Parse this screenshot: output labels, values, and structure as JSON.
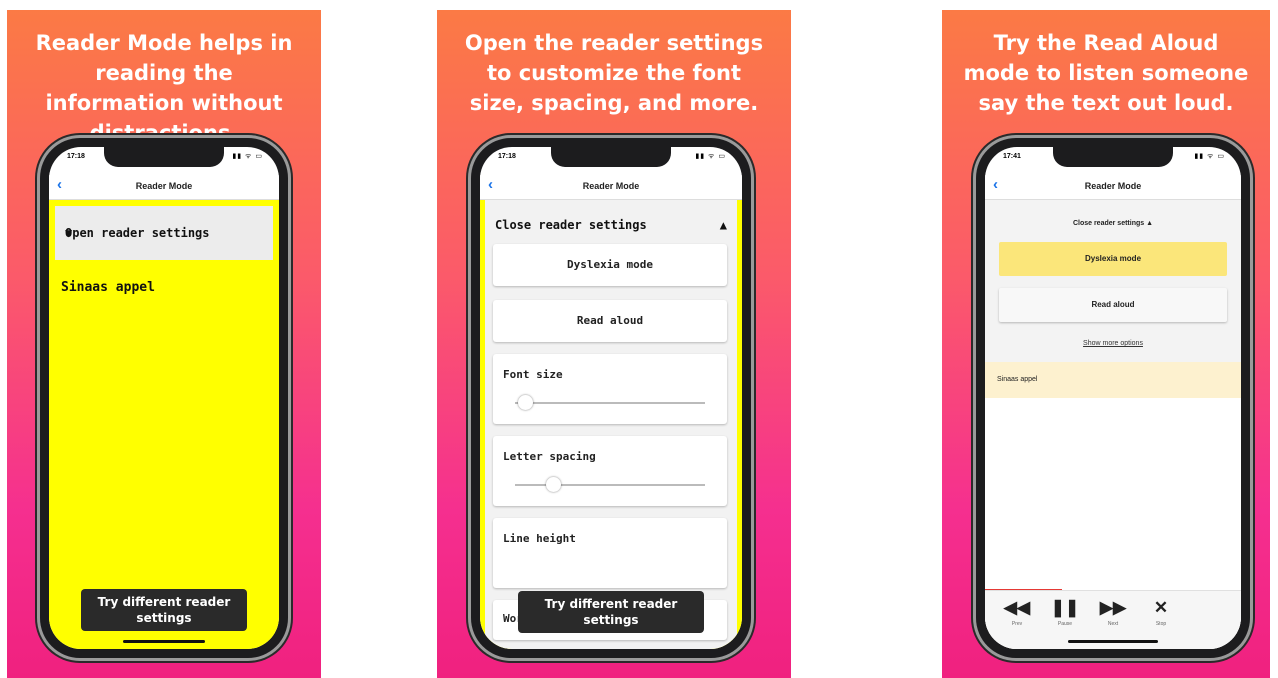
{
  "panels": [
    {
      "caption": "Reader Mode helps in reading the information without distractions.",
      "status_time": "17:18",
      "status_icons": "▮▮ ᯤ ▭",
      "nav_title": "Reader Mode",
      "settings_toggle_label": "Open reader settings",
      "settings_toggle_icon": "▼",
      "body_text": "Sinaas appel",
      "toast": "Try different reader settings"
    },
    {
      "caption": "Open the reader settings to customize the font size, spacing, and more.",
      "status_time": "17:18",
      "status_icons": "▮▮ ᯤ ▭",
      "nav_title": "Reader Mode",
      "settings_toggle_label": "Close reader settings",
      "settings_toggle_icon": "▲",
      "options": {
        "dyslexia_mode": "Dyslexia mode",
        "read_aloud": "Read aloud",
        "font_size": "Font size",
        "letter_spacing": "Letter spacing",
        "line_height": "Line height",
        "word_spacing": "Word spacing"
      },
      "font_size_value": 0.05,
      "letter_spacing_value": 0.2,
      "toast": "Try different reader settings"
    },
    {
      "caption": "Try the Read Aloud mode to listen someone say the text out loud.",
      "status_time": "17:41",
      "status_icons": "▮▮ ᯤ ▭",
      "nav_title": "Reader Mode",
      "settings_toggle_label": "Close reader settings ▲",
      "dyslexia_mode": "Dyslexia mode",
      "read_aloud": "Read aloud",
      "show_more": "Show more options",
      "body_text": "Sinaas appel",
      "playback_progress": 0.3,
      "controls": {
        "prev": "Prev",
        "pause": "Pause",
        "next": "Next",
        "stop": "Stop"
      }
    }
  ],
  "colors": {
    "gradient_top": "#fb7a45",
    "gradient_bottom": "#f0217f",
    "reader_yellow": "#ffff00",
    "dyslexia_highlight": "#fbe67a",
    "text_band": "#fdf1cf",
    "link_blue": "#1a73e8",
    "progress_red": "#e53935"
  },
  "icons": [
    "back-chevron-icon",
    "triangle-down-icon",
    "triangle-up-icon",
    "rewind-icon",
    "pause-icon",
    "fast-forward-icon",
    "close-x-icon"
  ]
}
